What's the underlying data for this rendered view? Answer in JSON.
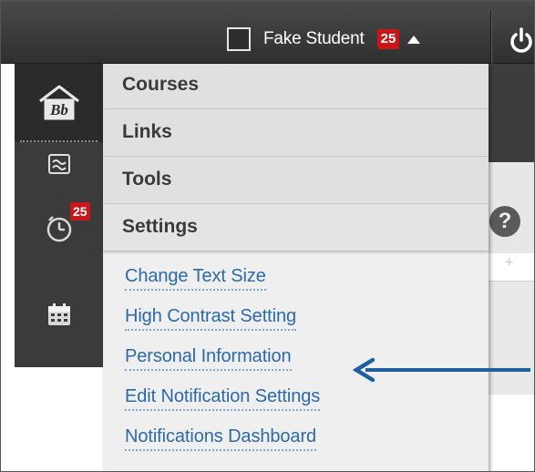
{
  "topbar": {
    "user_name": "Fake Student",
    "notification_count": "25",
    "icons": [
      "caret-up-icon",
      "power-icon"
    ]
  },
  "rail": {
    "home_logo_text": "Bb",
    "alerts_count": "25",
    "icons": [
      "blackboard-home-icon",
      "activity-stream-icon",
      "due-dates-clock-icon",
      "calendar-icon"
    ]
  },
  "menu": {
    "headers": [
      "Courses",
      "Links",
      "Tools",
      "Settings"
    ],
    "settings_links": [
      "Change Text Size",
      "High Contrast Setting",
      "Personal Information",
      "Edit Notification Settings",
      "Notifications Dashboard"
    ]
  },
  "page": {
    "help_glyph": "?",
    "plus_glyph": "+"
  },
  "colors": {
    "badge": "#c8161a",
    "link": "#2b6aa6",
    "arrow": "#1f5fa0",
    "topbar": "#3a3a3a"
  }
}
